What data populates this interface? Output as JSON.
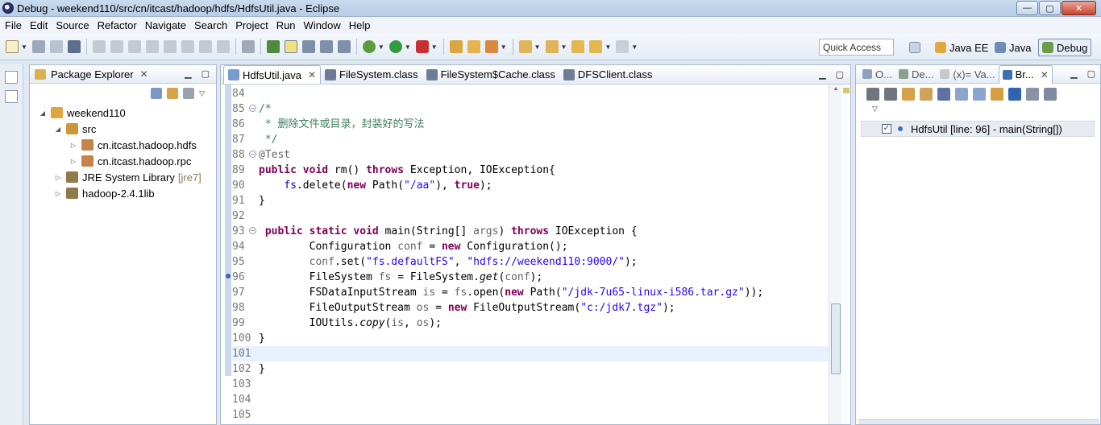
{
  "window": {
    "title": "Debug - weekend110/src/cn/itcast/hadoop/hdfs/HdfsUtil.java - Eclipse",
    "controls": {
      "minimize": "—",
      "maximize": "▢",
      "close": "✕"
    }
  },
  "menu": {
    "items": [
      "File",
      "Edit",
      "Source",
      "Refactor",
      "Navigate",
      "Search",
      "Project",
      "Run",
      "Window",
      "Help"
    ]
  },
  "toolbar": {
    "quick_access": "Quick Access",
    "perspectives": [
      {
        "label": "Java EE",
        "icon": "java-ee-perspective-icon",
        "active": false
      },
      {
        "label": "Java",
        "icon": "java-perspective-icon",
        "active": false
      },
      {
        "label": "Debug",
        "icon": "debug-perspective-icon",
        "active": true
      }
    ]
  },
  "package_explorer": {
    "title": "Package Explorer",
    "tree": [
      {
        "label": "weekend110",
        "extra": "",
        "level": 0,
        "expanded": true,
        "icon": "project-icon"
      },
      {
        "label": "src",
        "extra": "",
        "level": 1,
        "expanded": true,
        "icon": "source-folder-icon"
      },
      {
        "label": "cn.itcast.hadoop.hdfs",
        "extra": "",
        "level": 2,
        "expanded": false,
        "icon": "package-icon"
      },
      {
        "label": "cn.itcast.hadoop.rpc",
        "extra": "",
        "level": 2,
        "expanded": false,
        "icon": "package-icon"
      },
      {
        "label": "JRE System Library",
        "extra": "[jre7]",
        "level": 1,
        "expanded": false,
        "icon": "library-icon"
      },
      {
        "label": "hadoop-2.4.1lib",
        "extra": "",
        "level": 1,
        "expanded": false,
        "icon": "library-icon"
      }
    ]
  },
  "editor": {
    "tabs": [
      {
        "label": "HdfsUtil.java",
        "active": true,
        "icon": "java-file-icon"
      },
      {
        "label": "FileSystem.class",
        "active": false,
        "icon": "class-file-icon"
      },
      {
        "label": "FileSystem$Cache.class",
        "active": false,
        "icon": "class-file-icon"
      },
      {
        "label": "DFSClient.class",
        "active": false,
        "icon": "class-file-icon"
      }
    ],
    "current_line": "101",
    "lines": [
      {
        "n": "84",
        "fold": "",
        "tokens": []
      },
      {
        "n": "85",
        "fold": "−",
        "tokens": [
          {
            "t": "/*",
            "c": "cm"
          }
        ]
      },
      {
        "n": "86",
        "fold": "",
        "tokens": [
          {
            "t": " * 删除文件或目录，封装好的写法",
            "c": "cm"
          }
        ]
      },
      {
        "n": "87",
        "fold": "",
        "tokens": [
          {
            "t": " */",
            "c": "cm"
          }
        ]
      },
      {
        "n": "88",
        "fold": "−",
        "tokens": [
          {
            "t": "@Test",
            "c": "ann"
          }
        ]
      },
      {
        "n": "89",
        "fold": "",
        "tokens": [
          {
            "t": "public",
            "c": "kw"
          },
          {
            "t": " "
          },
          {
            "t": "void",
            "c": "kw"
          },
          {
            "t": " rm() "
          },
          {
            "t": "throws",
            "c": "kw"
          },
          {
            "t": " Exception, IOException{"
          }
        ]
      },
      {
        "n": "90",
        "fold": "",
        "tokens": [
          {
            "t": "    "
          },
          {
            "t": "fs",
            "c": "fld"
          },
          {
            "t": ".delete("
          },
          {
            "t": "new",
            "c": "kw"
          },
          {
            "t": " Path("
          },
          {
            "t": "\"/aa\"",
            "c": "str"
          },
          {
            "t": "), "
          },
          {
            "t": "true",
            "c": "kw"
          },
          {
            "t": ");"
          }
        ]
      },
      {
        "n": "91",
        "fold": "",
        "tokens": [
          {
            "t": "}"
          }
        ]
      },
      {
        "n": "92",
        "fold": "",
        "tokens": []
      },
      {
        "n": "93",
        "fold": "−",
        "tokens": [
          {
            "t": " "
          },
          {
            "t": "public",
            "c": "kw"
          },
          {
            "t": " "
          },
          {
            "t": "static",
            "c": "kw"
          },
          {
            "t": " "
          },
          {
            "t": "void",
            "c": "kw"
          },
          {
            "t": " main(String[] "
          },
          {
            "t": "args",
            "c": "ann"
          },
          {
            "t": ") "
          },
          {
            "t": "throws",
            "c": "kw"
          },
          {
            "t": " IOException {"
          }
        ]
      },
      {
        "n": "94",
        "fold": "",
        "tokens": [
          {
            "t": "        Configuration "
          },
          {
            "t": "conf",
            "c": "ann"
          },
          {
            "t": " = "
          },
          {
            "t": "new",
            "c": "kw"
          },
          {
            "t": " Configuration();"
          }
        ]
      },
      {
        "n": "95",
        "fold": "",
        "tokens": [
          {
            "t": "        "
          },
          {
            "t": "conf",
            "c": "ann"
          },
          {
            "t": ".set("
          },
          {
            "t": "\"fs.defaultFS\"",
            "c": "str"
          },
          {
            "t": ", "
          },
          {
            "t": "\"hdfs://weekend110:9000/\"",
            "c": "str"
          },
          {
            "t": ");"
          }
        ]
      },
      {
        "n": "96",
        "fold": "",
        "tokens": [
          {
            "t": "        FileSystem "
          },
          {
            "t": "fs",
            "c": "ann"
          },
          {
            "t": " = FileSystem."
          },
          {
            "t": "get",
            "c": "ital"
          },
          {
            "t": "("
          },
          {
            "t": "conf",
            "c": "ann"
          },
          {
            "t": ");"
          }
        ]
      },
      {
        "n": "97",
        "fold": "",
        "tokens": [
          {
            "t": "        FSDataInputStream "
          },
          {
            "t": "is",
            "c": "ann"
          },
          {
            "t": " = "
          },
          {
            "t": "fs",
            "c": "ann"
          },
          {
            "t": ".open("
          },
          {
            "t": "new",
            "c": "kw"
          },
          {
            "t": " Path("
          },
          {
            "t": "\"/jdk-7u65-linux-i586.tar.gz\"",
            "c": "str"
          },
          {
            "t": "));"
          }
        ]
      },
      {
        "n": "98",
        "fold": "",
        "tokens": [
          {
            "t": "        FileOutputStream "
          },
          {
            "t": "os",
            "c": "ann"
          },
          {
            "t": " = "
          },
          {
            "t": "new",
            "c": "kw"
          },
          {
            "t": " FileOutputStream("
          },
          {
            "t": "\"c:/jdk7.tgz\"",
            "c": "str"
          },
          {
            "t": ");"
          }
        ]
      },
      {
        "n": "99",
        "fold": "",
        "tokens": [
          {
            "t": "        IOUtils."
          },
          {
            "t": "copy",
            "c": "ital"
          },
          {
            "t": "("
          },
          {
            "t": "is",
            "c": "ann"
          },
          {
            "t": ", "
          },
          {
            "t": "os",
            "c": "ann"
          },
          {
            "t": ");"
          }
        ]
      },
      {
        "n": "100",
        "fold": "",
        "tokens": [
          {
            "t": "}"
          }
        ]
      },
      {
        "n": "101",
        "fold": "",
        "tokens": []
      },
      {
        "n": "102",
        "fold": "",
        "tokens": [
          {
            "t": "}"
          }
        ]
      },
      {
        "n": "103",
        "fold": "",
        "tokens": []
      },
      {
        "n": "104",
        "fold": "",
        "tokens": []
      },
      {
        "n": "105",
        "fold": "",
        "tokens": []
      }
    ]
  },
  "debug_views": {
    "tabs": [
      {
        "label": "O...",
        "active": false,
        "icon": "outline-icon"
      },
      {
        "label": "De...",
        "active": false,
        "icon": "debug-icon"
      },
      {
        "label": "(x)= Va...",
        "active": false,
        "icon": "variables-icon"
      },
      {
        "label": "Br...",
        "active": true,
        "icon": "breakpoints-icon"
      }
    ],
    "breakpoint": {
      "checked": true,
      "label": "HdfsUtil [line: 96] - main(String[])"
    }
  }
}
